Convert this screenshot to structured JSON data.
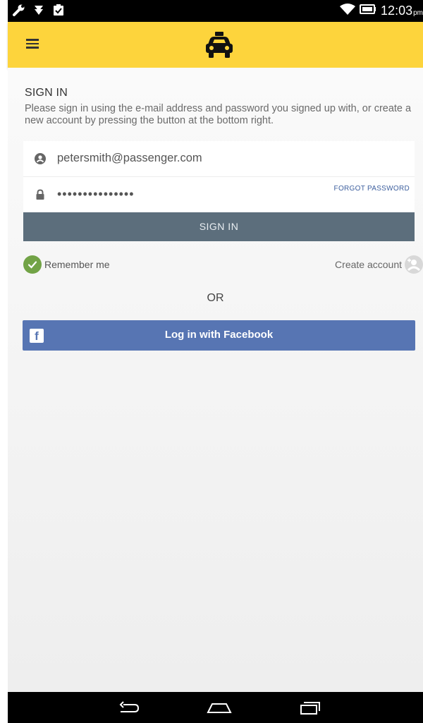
{
  "status_bar": {
    "time": "12:03",
    "ampm": "pm",
    "icons": [
      "wrench-icon",
      "download-icon",
      "clipboard-icon",
      "wifi-icon",
      "battery-icon"
    ]
  },
  "toolbar": {
    "menu_icon": "hamburger-menu-icon",
    "logo_icon": "taxi-icon",
    "color": "#fdd43c"
  },
  "signin": {
    "title": "SIGN IN",
    "description": "Please sign in using the e-mail address and password you signed up with, or create a new account by pressing the button at the bottom right.",
    "email_value": "petersmith@passenger.com",
    "password_value": "•••••••••••••••",
    "forgot_password_label": "FORGOT PASSWORD",
    "signin_button_label": "SIGN IN",
    "remember_me_label": "Remember me",
    "remember_me_checked": true,
    "create_account_label": "Create account",
    "or_label": "OR",
    "facebook_button_label": "Log in with Facebook"
  },
  "nav_bar": {
    "icons": [
      "back-icon",
      "home-icon",
      "recents-icon"
    ]
  },
  "colors": {
    "accent_yellow": "#fdd43c",
    "signin_button": "#5c6e7c",
    "facebook": "#5775b3",
    "check_green": "#72a346"
  }
}
